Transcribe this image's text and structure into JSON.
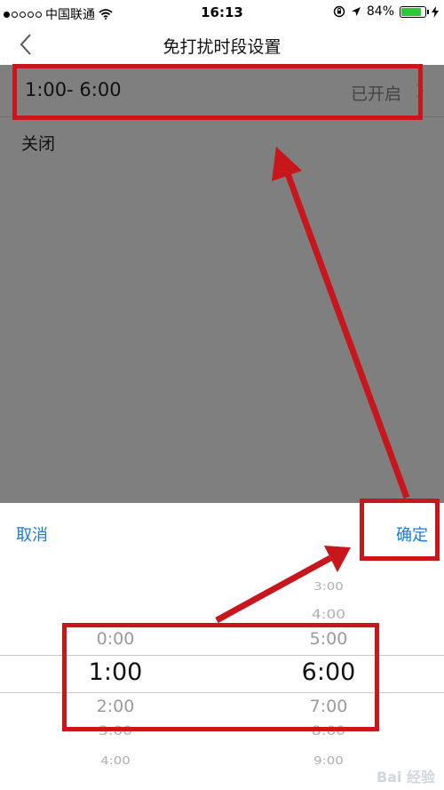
{
  "status_bar": {
    "carrier": "中国联通",
    "time": "16:13",
    "battery_percent": "84%",
    "battery_level": 0.84,
    "battery_color": "#2fc63a",
    "signal_dots": [
      "filled",
      "empty",
      "empty",
      "empty",
      "empty"
    ],
    "icons": [
      "wifi-icon",
      "orientation-lock-icon",
      "location-arrow-icon",
      "battery-icon",
      "charging-bolt-icon"
    ]
  },
  "nav": {
    "title": "免打扰时段设置",
    "back_icon": "chevron-left-icon"
  },
  "setting_row": {
    "time_range": "1:00- 6:00",
    "status": "已开启",
    "chevron_icon": "chevron-right-icon"
  },
  "close_label": "关闭",
  "sheet": {
    "cancel_label": "取消",
    "confirm_label": "确定"
  },
  "picker": {
    "start_options": [
      "0:00",
      "1:00",
      "2:00",
      "3:00",
      "4:00"
    ],
    "start_selected": "1:00",
    "end_options": [
      "3:00",
      "4:00",
      "5:00",
      "6:00",
      "7:00",
      "8:00",
      "9:00"
    ],
    "end_selected": "6:00"
  },
  "colors": {
    "accent": "#1a7ad8",
    "overlay": "#7f7f7f",
    "annotation": "#c8161d"
  },
  "watermark": "Bai 经验"
}
